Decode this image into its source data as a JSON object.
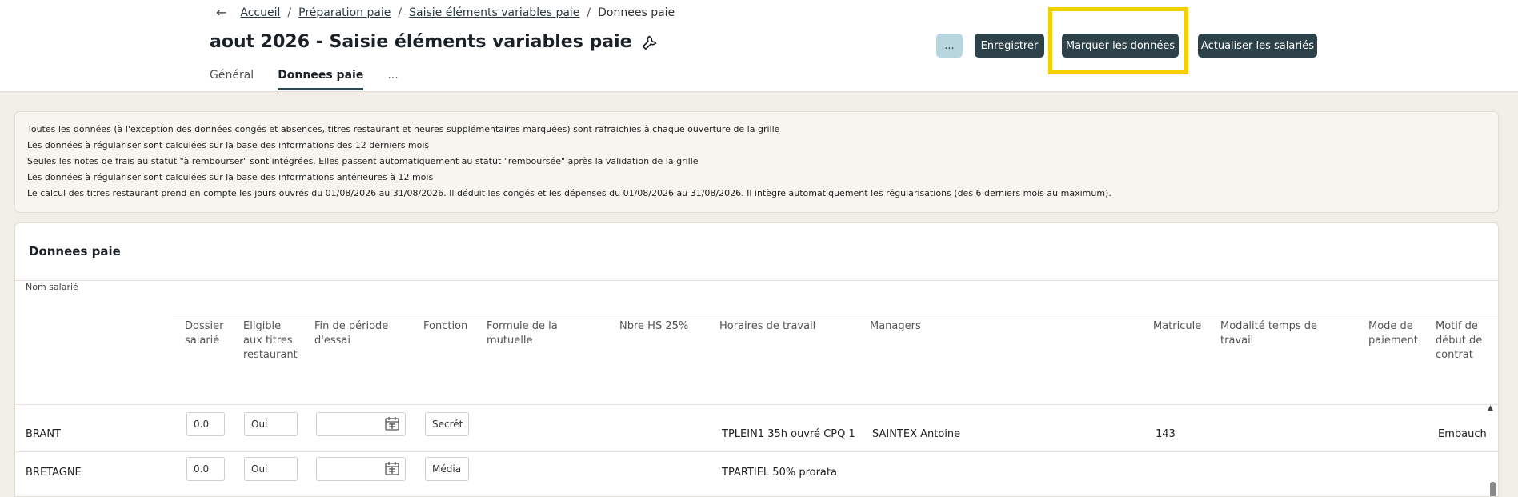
{
  "breadcrumb": {
    "items": [
      "Accueil",
      "Préparation paie",
      "Saisie éléments variables paie"
    ],
    "current": "Donnees paie",
    "separator": "/"
  },
  "page": {
    "title": "aout 2026 - Saisie éléments variables paie"
  },
  "tabs": [
    {
      "label": "Général"
    },
    {
      "label": "Donnees paie"
    },
    {
      "label": "..."
    }
  ],
  "toolbar": {
    "more_label": "...",
    "save_label": "Enregistrer",
    "mark_label": "Marquer les données",
    "refresh_label": "Actualiser les salariés"
  },
  "info": [
    "Toutes les données (à l'exception des données congés et absences, titres restaurant et heures supplémentaires marquées) sont rafraichies à chaque ouverture de la grille",
    "Les données à régulariser sont calculées sur la base des informations des 12 derniers mois",
    "Seules les notes de frais au statut \"à rembourser\" sont intégrées. Elles passent automatiquement au statut \"remboursée\" après la validation de la grille",
    "Les données à régulariser sont calculées sur la base des informations antérieures à 12 mois",
    "Le calcul des titres restaurant prend en compte les jours ouvrés du 01/08/2026 au 31/08/2026. Il déduit les congés et les dépenses du 01/08/2026 au 31/08/2026. Il intègre automatiquement les régularisations (des 6 derniers mois au maximum)."
  ],
  "grid": {
    "title": "Donnees paie",
    "name_column": "Nom salarié",
    "columns": [
      "Dossier salarié",
      "Eligible aux titres restaurant",
      "Fin de période d'essai",
      "Fonction",
      "Formule de la mutuelle",
      "Nbre HS 25%",
      "Horaires de travail",
      "Managers",
      "Matricule",
      "Modalité temps de travail",
      "Mode de paiement",
      "Motif de début de contrat"
    ],
    "rows": [
      {
        "name": "BRANT",
        "dossier": "0.0",
        "eligible": "Oui",
        "fin_essai": "",
        "fonction": "Secrét",
        "horaires": "TPLEIN1 35h ouvré CPQ 1",
        "managers": "SAINTEX Antoine",
        "matricule": "143",
        "motif": "Embauche"
      },
      {
        "name": "BRETAGNE",
        "dossier": "0.0",
        "eligible": "Oui",
        "fin_essai": "",
        "fonction": "Média",
        "horaires": "TPARTIEL 50% prorata",
        "managers": "",
        "matricule": "",
        "motif": ""
      }
    ]
  },
  "colors": {
    "button_dark": "#2d4248",
    "button_light": "#b7d6de",
    "highlight": "#f5d000",
    "page_bg": "#f2efe8"
  }
}
